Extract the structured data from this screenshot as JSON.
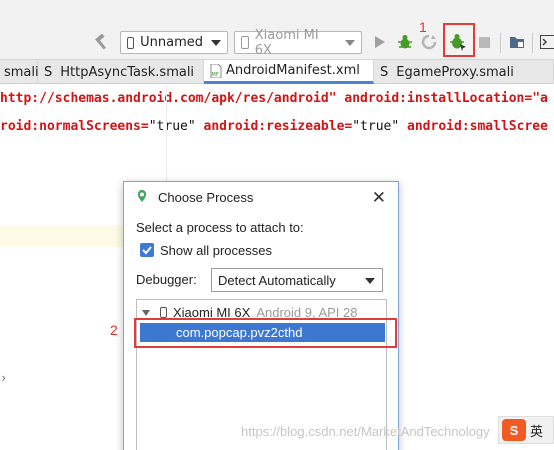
{
  "toolbar": {
    "config_combo": "Unnamed",
    "device_combo": "Xiaomi MI 6X",
    "icons": [
      "hammer-icon",
      "run-icon",
      "debug-icon",
      "apply-changes-icon",
      "attach-debugger-icon",
      "stop-icon",
      "sdk-manager-icon",
      "terminal-icon"
    ]
  },
  "tabs": [
    {
      "prefix": "",
      "label": "smali"
    },
    {
      "prefix": "S",
      "label": "HttpAsyncTask.smali"
    },
    {
      "prefix": "MF",
      "label": "AndroidManifest.xml"
    },
    {
      "prefix": "S",
      "label": "EgameProxy.smali"
    }
  ],
  "code": {
    "line1": "http://schemas.android.com/apk/res/android\" android:installLocation=\"a",
    "line2_parts": [
      "roid:normalScreens=",
      "\"true\"",
      " android:resizeable=",
      "\"true\"",
      " android:smallScree"
    ]
  },
  "dialog": {
    "title": "Choose Process",
    "prompt": "Select a process to attach to:",
    "show_all_label": "Show all processes",
    "show_all_checked": true,
    "debugger_label": "Debugger:",
    "debugger_value": "Detect Automatically",
    "device_name": "Xiaomi MI 6X",
    "device_info": "Android 9, API 28",
    "process": "com.popcap.pvz2cthd"
  },
  "annotations": {
    "one": "1",
    "two": "2"
  },
  "watermark": "https://blog.csdn.net/MarketAndTechnology",
  "ime": {
    "logo": "S",
    "lang": "英"
  },
  "colors": {
    "selection": "#3c78d0",
    "annotation": "#e23b3b",
    "xml_attr": "#d21414",
    "debug_green": "#4a9a2a"
  }
}
